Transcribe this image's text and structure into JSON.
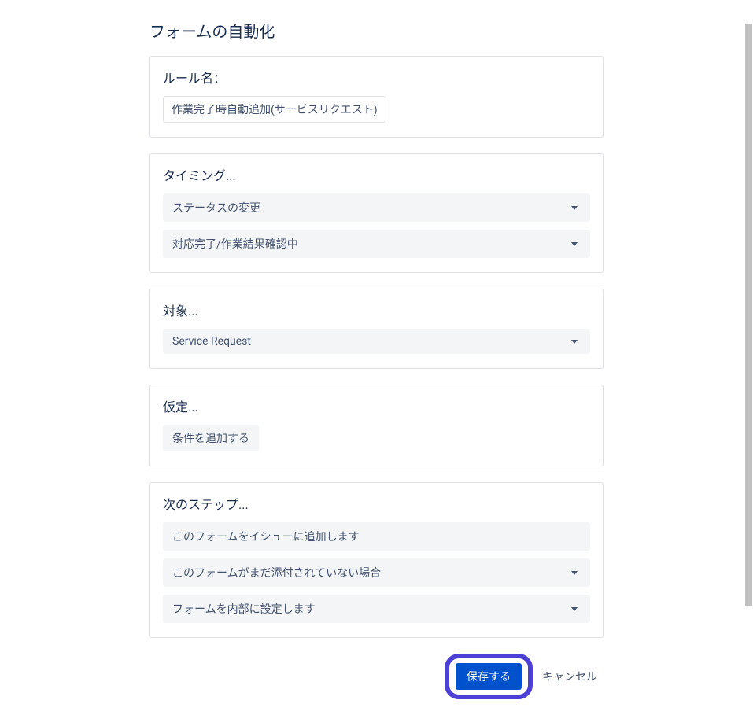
{
  "page": {
    "title": "フォームの自動化"
  },
  "rule_name": {
    "heading": "ルール名：",
    "chip_value": "作業完了時自動追加(サービスリクエスト)"
  },
  "timing": {
    "heading": "タイミング...",
    "trigger": "ステータスの変更",
    "status": "対応完了/作業結果確認中"
  },
  "target": {
    "heading": "対象...",
    "value": "Service Request"
  },
  "assumption": {
    "heading": "仮定...",
    "add_condition_label": "条件を追加する"
  },
  "next_steps": {
    "heading": "次のステップ...",
    "step1": "このフォームをイシューに追加します",
    "step2": "このフォームがまだ添付されていない場合",
    "step3": "フォームを内部に設定します"
  },
  "footer": {
    "save_label": "保存する",
    "cancel_label": "キャンセル"
  }
}
